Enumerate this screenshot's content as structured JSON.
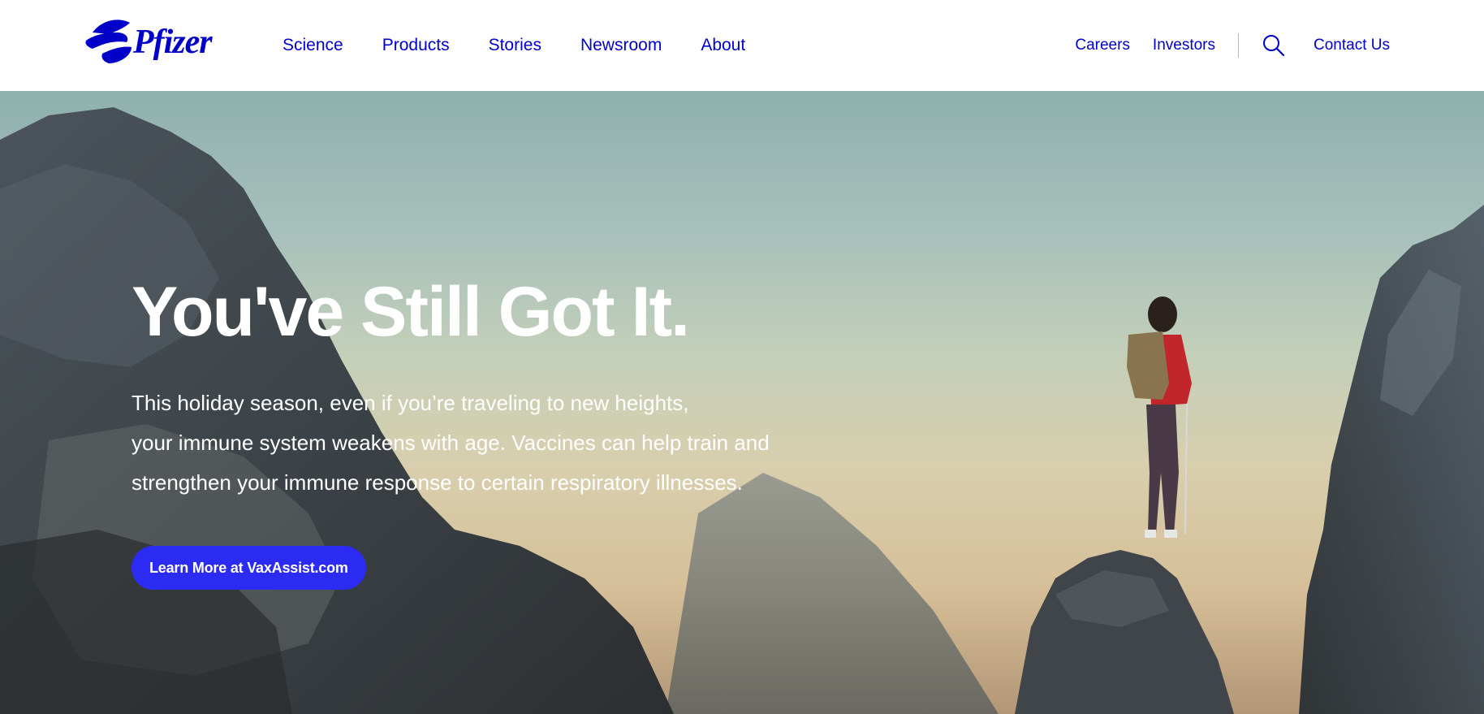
{
  "brand": {
    "name": "Pfizer",
    "color": "#0000c9"
  },
  "main_nav": [
    {
      "label": "Science"
    },
    {
      "label": "Products"
    },
    {
      "label": "Stories"
    },
    {
      "label": "Newsroom"
    },
    {
      "label": "About"
    }
  ],
  "utility_nav": {
    "careers": "Careers",
    "investors": "Investors",
    "search_icon": "search-icon",
    "contact": "Contact Us"
  },
  "hero": {
    "title": "You've Still Got It.",
    "body_lines": [
      "This holiday season, even if you’re traveling to new heights,",
      "your immune system weakens with age. Vaccines can help train and",
      "strengthen your immune response to certain respiratory illnesses."
    ],
    "cta_label": "Learn More at VaxAssist.com",
    "cta_color": "#2b2bf4"
  }
}
